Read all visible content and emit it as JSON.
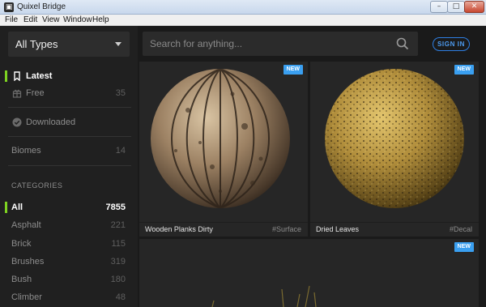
{
  "window": {
    "title": "Quixel Bridge",
    "icon_glyph": "▣",
    "min_glyph": "–",
    "max_glyph": "□",
    "close_glyph": "✕"
  },
  "menu": [
    "File",
    "Edit",
    "View",
    "Window",
    "Help"
  ],
  "sidebar": {
    "type_select": "All Types",
    "items": [
      {
        "label": "Latest",
        "count": "",
        "icon": "bookmark-icon",
        "active": true
      },
      {
        "label": "Free",
        "count": "35",
        "icon": "gift-icon"
      },
      {
        "label": "Downloaded",
        "count": "",
        "icon": "check-circle-icon"
      },
      {
        "label": "Biomes",
        "count": "14",
        "icon": ""
      }
    ],
    "categories_heading": "CATEGORIES",
    "categories": [
      {
        "label": "All",
        "count": "7855",
        "active": true
      },
      {
        "label": "Asphalt",
        "count": "221"
      },
      {
        "label": "Brick",
        "count": "115"
      },
      {
        "label": "Brushes",
        "count": "319"
      },
      {
        "label": "Bush",
        "count": "180"
      },
      {
        "label": "Climber",
        "count": "48"
      }
    ],
    "accent_color": "#7ed321"
  },
  "main": {
    "search_placeholder": "Search for anything...",
    "sign_in": "SIGN IN",
    "cards": [
      {
        "name": "Wooden Planks Dirty",
        "tag": "#Surface",
        "badge": "NEW"
      },
      {
        "name": "Dried Leaves",
        "tag": "#Decal",
        "badge": "NEW"
      },
      {
        "name": "",
        "tag": "",
        "badge": "NEW"
      }
    ],
    "badge_color": "#3a9ff0",
    "signin_color": "#2e7fe3"
  }
}
